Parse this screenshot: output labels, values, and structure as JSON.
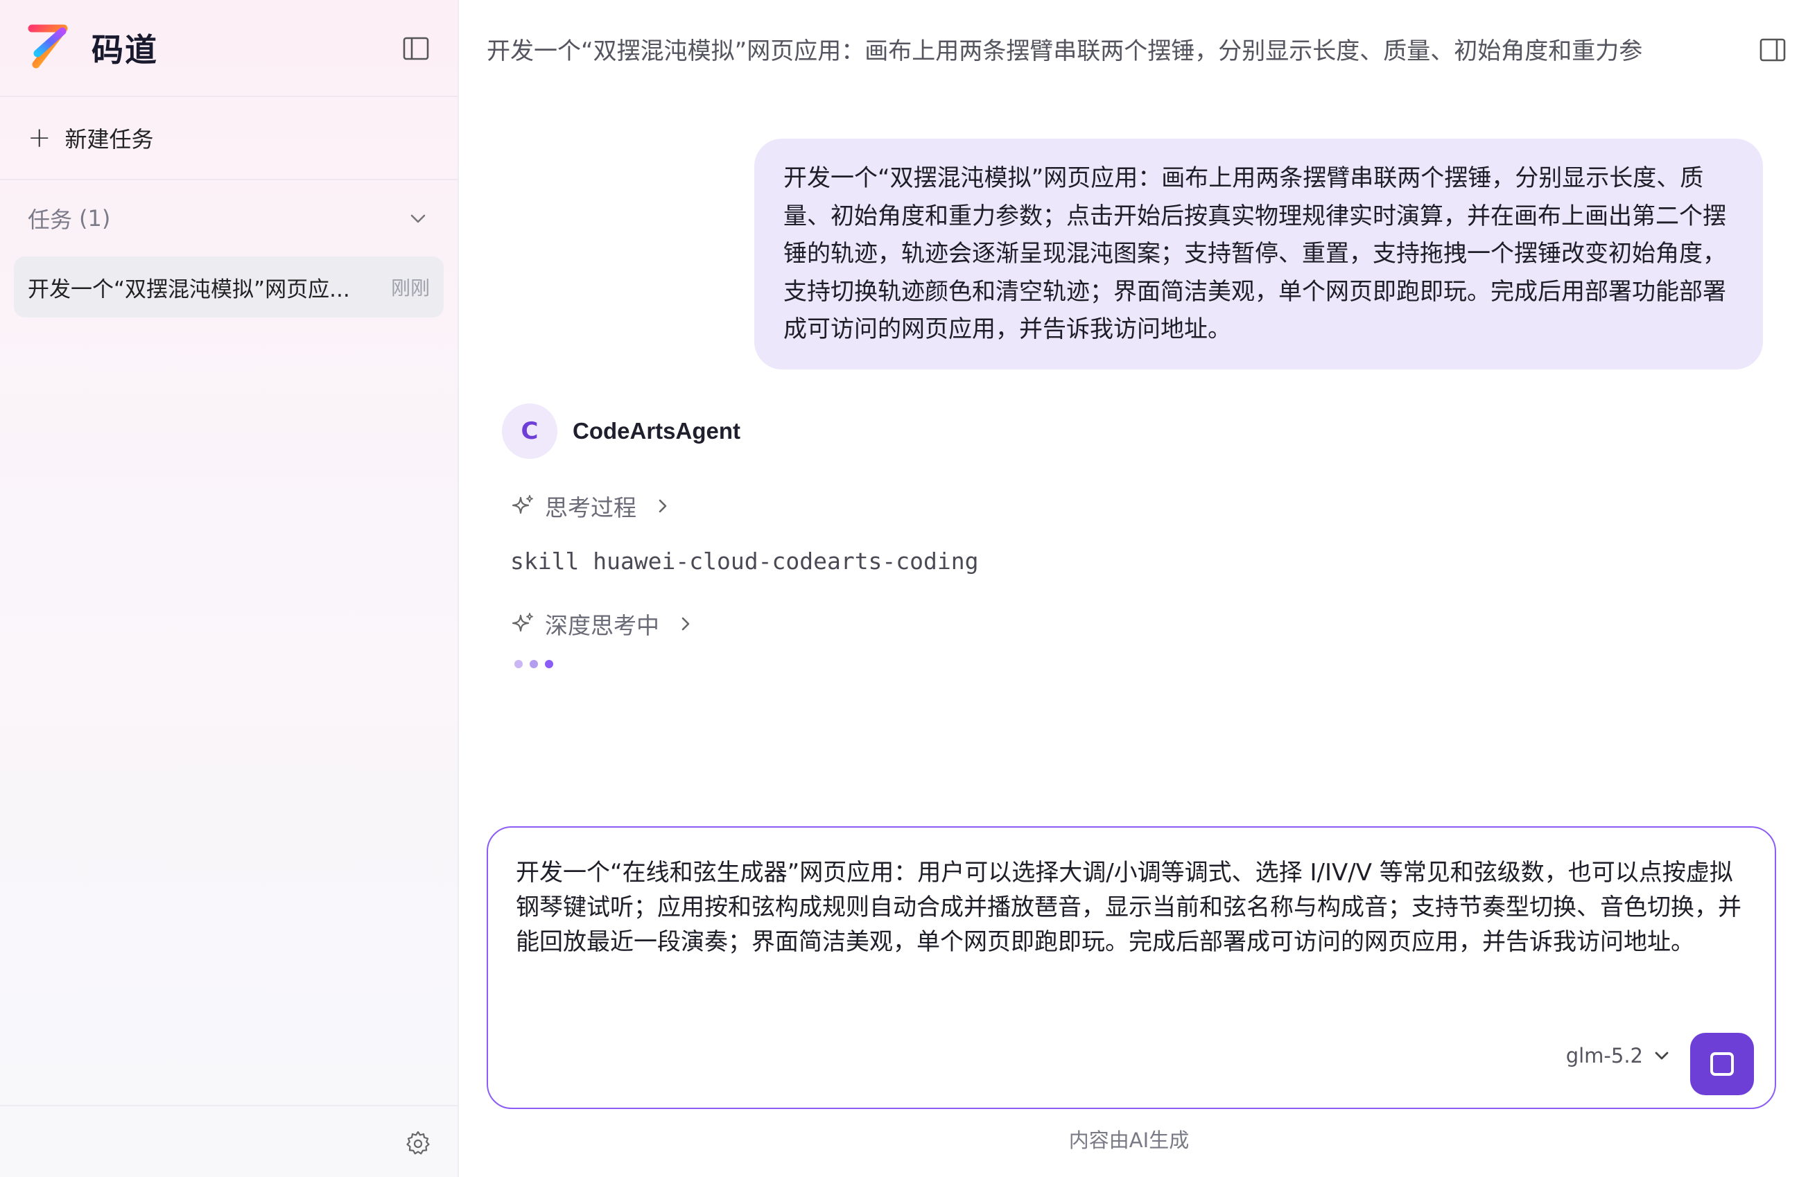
{
  "sidebar": {
    "brand": "码道",
    "new_task_label": "新建任务",
    "tasks_label": "任务",
    "tasks_count": "(1)",
    "tasks": [
      {
        "title": "开发一个“双摆混沌模拟”网页应...",
        "time": "刚刚"
      }
    ]
  },
  "main": {
    "topbar_title": "开发一个“双摆混沌模拟”网页应用：画布上用两条摆臂串联两个摆锤，分别显示长度、质量、初始角度和重力参",
    "user_message": "开发一个“双摆混沌模拟”网页应用：画布上用两条摆臂串联两个摆锤，分别显示长度、质量、初始角度和重力参数；点击开始后按真实物理规律实时演算，并在画布上画出第二个摆锤的轨迹，轨迹会逐渐呈现混沌图案；支持暂停、重置，支持拖拽一个摆锤改变初始角度，支持切换轨迹颜色和清空轨迹；界面简洁美观，单个网页即跑即玩。完成后用部署功能部署成可访问的网页应用，并告诉我访问地址。",
    "agent": {
      "avatar_letter": "C",
      "name": "CodeArtsAgent",
      "thinking_label": "思考过程",
      "skill_line": "skill huawei-cloud-codearts-coding",
      "deep_thinking_label": "深度思考中"
    },
    "composer": {
      "text": "开发一个“在线和弦生成器”网页应用：用户可以选择大调/小调等调式、选择 I/IV/V 等常见和弦级数，也可以点按虚拟钢琴键试听；应用按和弦构成规则自动合成并播放琶音，显示当前和弦名称与构成音；支持节奏型切换、音色切换，并能回放最近一段演奏；界面简洁美观，单个网页即跑即玩。完成后部署成可访问的网页应用，并告诉我访问地址。",
      "model": "glm-5.2"
    },
    "disclaimer": "内容由AI生成"
  },
  "colors": {
    "accent": "#6d3fd6",
    "user_bubble": "#ede7fb",
    "composer_border": "#8b5cf6"
  },
  "icons": {
    "sidebar_toggle": "sidebar-toggle-icon",
    "plus": "plus-icon",
    "chevron_down": "chevron-down-icon",
    "gear": "gear-icon",
    "panel_toggle": "panel-toggle-icon",
    "sparkle": "sparkle-icon",
    "chevron_right": "chevron-right-icon",
    "stop": "stop-icon"
  }
}
